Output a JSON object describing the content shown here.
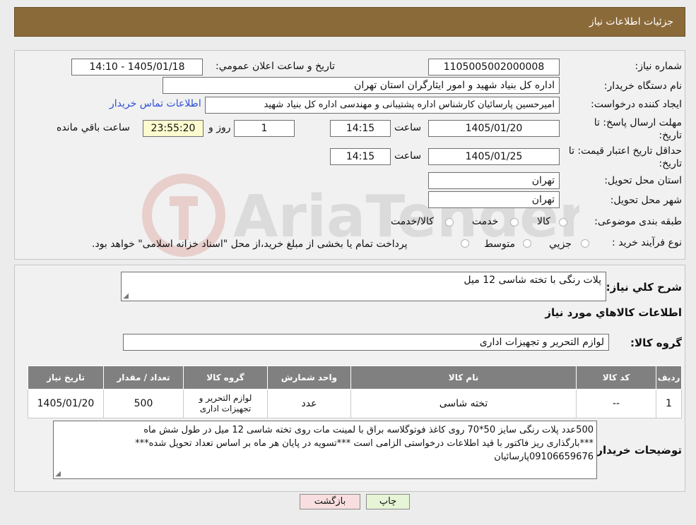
{
  "header": {
    "title": "جزئیات اطلاعات نیاز"
  },
  "labels": {
    "need_number": "شماره نیاز:",
    "announce_datetime": "تاریخ و ساعت اعلان عمومي:",
    "buyer_org": "نام دستگاه خريدار:",
    "requester": "ایجاد کننده درخواست:",
    "deadline_l1": "مهلت ارسال پاسخ: تا",
    "deadline_l2": "تاریخ:",
    "hour": "ساعت",
    "day_and": "روز و",
    "remaining": "ساعت باقي مانده",
    "validity_l1": "حداقل تاريخ اعتبار قيمت: تا",
    "validity_l2": "تاريخ:",
    "province": "استان محل تحویل:",
    "city": "شهر محل تحویل:",
    "category": "طبقه بندی موضوعی:",
    "purchase_type": "نوع فرآیند خرید :",
    "summary": "شرح کلي نياز:",
    "goods_info": "اطلاعات کالاهاي مورد نياز",
    "goods_group": "گروه کالا:",
    "buyer_notes": "توضیحات خریدار:"
  },
  "values": {
    "need_number": "1105005002000008",
    "announce_datetime": "1405/01/18 - 14:10",
    "buyer_org": "اداره کل بنیاد شهید و امور ایثارگران استان تهران",
    "requester": "امیرحسین پارسائیان کارشناس اداره پشتیبانی و مهندسی  اداره کل بنیاد شهید",
    "deadline_date": "1405/01/20",
    "deadline_time": "14:15",
    "days": "1",
    "remaining_time": "23:55:20",
    "validity_date": "1405/01/25",
    "validity_time": "14:15",
    "province": "تهران",
    "city": "تهران",
    "summary": "پلات رنگی با تخته شاسی 12 میل",
    "goods_group": "لوازم التحریر و تجهیزات اداری",
    "buyer_notes_l1": "500عدد پلات رنگی سایز 50*70 روی کاغذ فوتوگلاسه براق با لمینت مات روی تخته شاسی 12 میل در طول شش ماه",
    "buyer_notes_l2": "***بارگذاری ریز فاکتور با قید اطلاعات درخواستی الزامی است ***تسویه در پایان هر ماه بر اساس تعداد تحویل شده***",
    "buyer_notes_l3": "09106659676پارسائیان"
  },
  "contact_link": "اطلاعات تماس خریدار",
  "category_options": [
    "کالا",
    "خدمت",
    "کالا/خدمت"
  ],
  "purchase_options": [
    "جزیي",
    "متوسط"
  ],
  "purchase_note": "پرداخت تمام یا بخشی از مبلغ خرید،از محل \"اسناد خزانه اسلامی\" خواهد بود.",
  "watermark": "AriaTender.neT",
  "table": {
    "headers": [
      "ردیف",
      "کد کالا",
      "نام کالا",
      "واحد شمارش",
      "گروه کالا",
      "تعداد / مقدار",
      "تاریخ نیاز"
    ],
    "rows": [
      {
        "row": "1",
        "code": "--",
        "name": "تخته شاسی",
        "unit": "عدد",
        "group": "لوازم التحریر و تجهیزات اداری",
        "qty": "500",
        "date": "1405/01/20"
      }
    ]
  },
  "buttons": {
    "print": "چاپ",
    "back": "بازگشت"
  },
  "colors": {
    "header_bg": "#8b6a3a",
    "print_btn": "#e6f5d6",
    "back_btn": "#f8dede",
    "link": "#2b4fd6"
  }
}
